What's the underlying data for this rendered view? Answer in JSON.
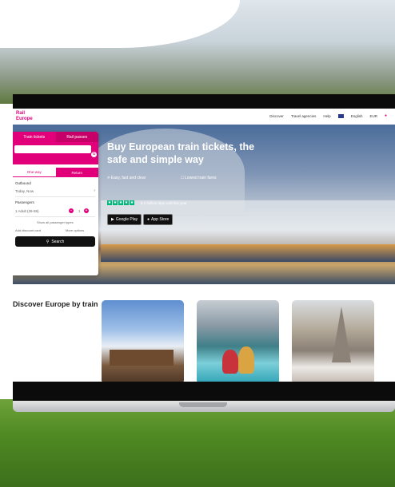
{
  "header": {
    "logo_line1": "Rail",
    "logo_line2": "Europe",
    "nav": [
      "Discover",
      "Travel agencies",
      "Help",
      "English",
      "EUR"
    ]
  },
  "hero": {
    "title": "Buy European train tickets, the safe and simple way",
    "feature1": "Easy, fast and clear",
    "feature2": "Lowest train fares",
    "trust_text": "6,4 million trips sold this year",
    "app_buttons": [
      "Google Play",
      "App Store"
    ]
  },
  "search_panel": {
    "tab_train": "Train tickets",
    "tab_passes": "Rail passes",
    "trip_oneway": "One-way",
    "trip_return": "Return",
    "outbound_label": "Outbound",
    "outbound_value": "Today, Now",
    "passengers_label": "Passengers",
    "passenger_value": "1 Adult (26-59)",
    "passenger_count": "1",
    "passenger_types_link": "Show all passenger types",
    "discount_label": "Add discount card",
    "more_options": "More options",
    "search_label": "Search"
  },
  "discover": {
    "title": "Discover Europe by train"
  },
  "colors": {
    "brand": "#e2007a",
    "button_dark": "#111111",
    "trustpilot_green": "#00b67a"
  },
  "icons": [
    "search-icon",
    "swap-icon",
    "chevron-right-icon",
    "plus-icon",
    "minus-icon",
    "star-icon",
    "google-play-icon",
    "apple-icon",
    "fast-icon",
    "fare-icon",
    "profile-icon"
  ]
}
